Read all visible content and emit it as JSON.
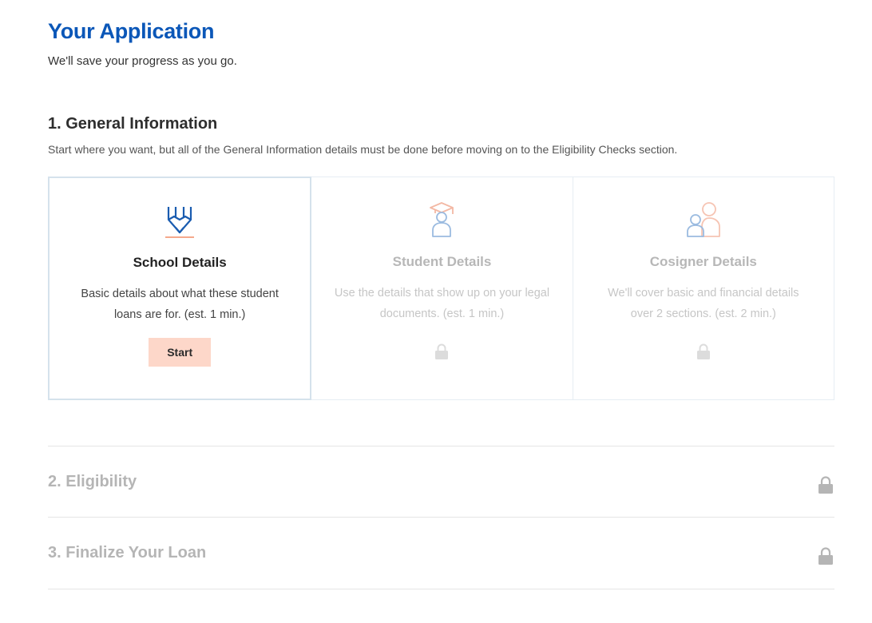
{
  "header": {
    "title": "Your Application",
    "subtitle": "We'll save your progress as you go."
  },
  "section1": {
    "title": "1. General Information",
    "description": "Start where you want, but all of the General Information details must be done before moving on to the Eligibility Checks section.",
    "cards": [
      {
        "title": "School Details",
        "description": "Basic details about what these student loans are for. (est. 1 min.)",
        "button_label": "Start",
        "icon": "pencil-icon",
        "state": "active"
      },
      {
        "title": "Student Details",
        "description": "Use the details that show up on your legal documents. (est. 1 min.)",
        "icon": "graduate-icon",
        "state": "locked"
      },
      {
        "title": "Cosigner Details",
        "description": "We'll cover basic and financial details over 2 sections. (est. 2 min.)",
        "icon": "cosigner-icon",
        "state": "locked"
      }
    ]
  },
  "section2": {
    "title": "2. Eligibility",
    "state": "locked"
  },
  "section3": {
    "title": "3. Finalize Your Loan",
    "state": "locked"
  },
  "colors": {
    "brand_blue": "#0b57b8",
    "accent_peach": "#fdd7c9",
    "locked_gray": "#b5b5b5"
  }
}
